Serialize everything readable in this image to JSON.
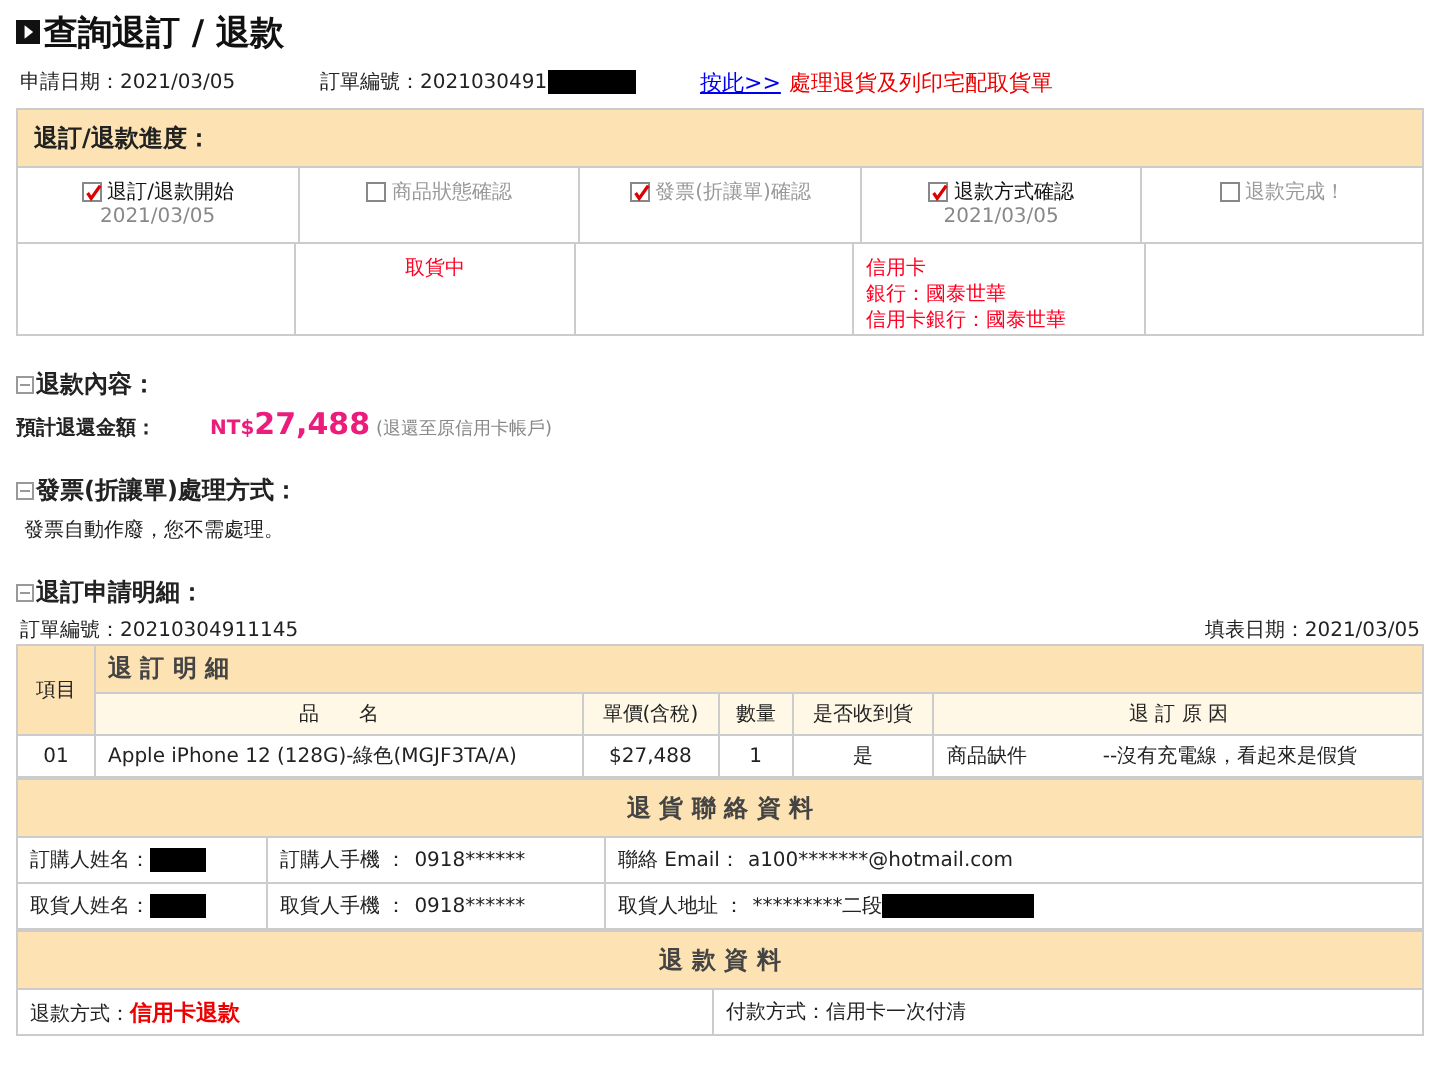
{
  "title": "查詢退訂 / 退款",
  "info": {
    "apply_date": "申請日期：2021/03/05",
    "order_no": "訂單編號：2021030491",
    "link": "按此>>",
    "link_note": "處理退貨及列印宅配取貨單"
  },
  "progress": {
    "heading": "退訂/退款進度：",
    "steps": [
      {
        "label": "退訂/退款開始",
        "checked": true,
        "active": true,
        "date": "2021/03/05"
      },
      {
        "label": "商品狀態確認",
        "checked": false,
        "active": false,
        "notes": [
          "取貨中"
        ]
      },
      {
        "label": "發票(折讓單)確認",
        "checked": true,
        "active": false
      },
      {
        "label": "退款方式確認",
        "checked": true,
        "active": true,
        "date": "2021/03/05",
        "notes": [
          "信用卡",
          "銀行：國泰世華",
          "信用卡銀行：國泰世華"
        ]
      },
      {
        "label": "退款完成！",
        "checked": false,
        "active": false
      }
    ]
  },
  "refund": {
    "heading": "退款內容：",
    "label": "預計退還金額：",
    "currency": "NT$",
    "amount": "27,488",
    "note": "(退還至原信用卡帳戶)"
  },
  "invoice": {
    "heading": "發票(折讓單)處理方式：",
    "text": "發票自動作廢，您不需處理。"
  },
  "detail": {
    "heading": "退訂申請明細：",
    "order_no": "訂單編號：20210304911145",
    "fill_date": "填表日期：2021/03/05",
    "item_header": "項目",
    "title": "退 訂 明 細",
    "columns": [
      "品　　名",
      "單價(含稅)",
      "數量",
      "是否收到貨",
      "退 訂 原 因"
    ],
    "rows": [
      {
        "no": "01",
        "name": "Apple iPhone 12 (128G)-綠色(MGJF3TA/A)",
        "price": "$27,488",
        "qty": "1",
        "received": "是",
        "reason": "商品缺件",
        "reason_detail": "--沒有充電線，看起來是假貨"
      }
    ]
  },
  "contact": {
    "title": "退 貨 聯 絡 資 料",
    "rows": [
      [
        {
          "label": "訂購人姓名：",
          "redacted": true
        },
        {
          "label": "訂購人手機 ：",
          "value": "0918******",
          "redacted": false
        },
        {
          "label": "聯絡 Email：",
          "value": "a100*******@hotmail.com",
          "redacted": false
        }
      ],
      [
        {
          "label": "取貨人姓名：",
          "redacted": true
        },
        {
          "label": "取貨人手機 ：",
          "value": "0918******",
          "redacted": false
        },
        {
          "label": "取貨人地址 ：",
          "value": "*********二段",
          "redacted": true
        }
      ]
    ]
  },
  "refund_info": {
    "title": "退 款 資 料",
    "method_label": "退款方式：",
    "method": "信用卡退款",
    "payment": "付款方式：信用卡一次付清"
  }
}
